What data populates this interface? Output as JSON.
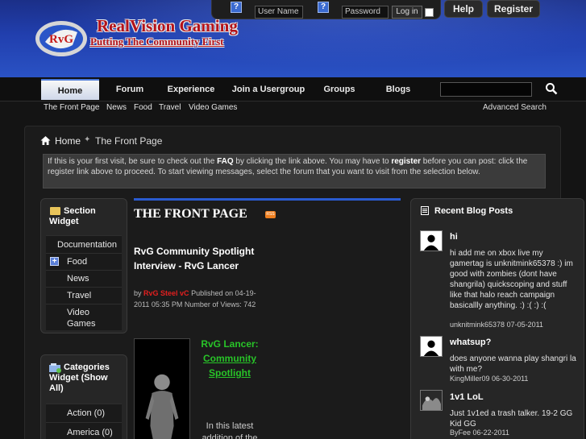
{
  "site": {
    "name": "RealVision Gaming",
    "slogan": "Putting The Community First",
    "badge": "RvG"
  },
  "login": {
    "username_placeholder": "User Name",
    "password_placeholder": "Password",
    "login_button": "Log in",
    "help_glyph": "?"
  },
  "top_tabs": {
    "help": "Help",
    "register": "Register"
  },
  "nav": {
    "tabs": [
      "Home",
      "Forum",
      "Experience",
      "Join a Usergroup",
      "Groups",
      "Blogs"
    ],
    "subnav": [
      "The Front Page",
      "News",
      "Food",
      "Travel",
      "Video Games"
    ],
    "advanced_search": "Advanced Search"
  },
  "breadcrumb": {
    "home": "Home",
    "separator": "✦",
    "current": "The Front Page"
  },
  "notice": {
    "part1": "If this is your first visit, be sure to check out the ",
    "faq": "FAQ",
    "part2": " by clicking the link above. You may have to ",
    "register": "register",
    "part3": " before you can post: click the register link above to proceed. To start viewing messages, select the forum that you want to visit from the selection below."
  },
  "section_widget": {
    "title": "Section Widget",
    "items": [
      "Documentation",
      "Food",
      "News",
      "Travel",
      "Video Games"
    ],
    "plus_glyph": "+"
  },
  "categories_widget": {
    "title": "Categories Widget (Show All)",
    "items": [
      "Action (0)",
      "America (0)"
    ]
  },
  "center": {
    "title": "THE FRONT PAGE",
    "rss_label": "RSS",
    "article": {
      "title": "RvG Community Spotlight Interview - RvG Lancer",
      "by": "by",
      "author": "RvG Steel vC",
      "published": "Published on 04-19-2011 05:35 PM",
      "views_label": "Number of Views:",
      "views": "742",
      "heading_line1": "RvG Lancer:",
      "heading_link": "Community Spotlight",
      "body": "In this latest addition of the"
    }
  },
  "recent_blog_posts": {
    "title": "Recent Blog Posts",
    "posts": [
      {
        "title": "hi",
        "body": "hi add me on xbox live my gamertag is unknitmink65378 :) im good with zombies (dont have shangrila) quickscoping and stuff like that halo reach campaign basicallly anything. :) :( :) :(",
        "author": "unknitmink65378",
        "date": "07-05-2011"
      },
      {
        "title": "whatsup?",
        "body": "does anyone wanna play shangri la with me?",
        "author": "KingMiller09",
        "date": "06-30-2011"
      },
      {
        "title": "1v1 LoL",
        "body": "Just 1v1ed a trash talker. 19-2 GG Kid GG",
        "author": "ByFee",
        "date": "06-22-2011"
      }
    ]
  },
  "colors": {
    "header_blue": "#213fae",
    "brand_red": "#b3121a",
    "accent_blue": "#2a5bd0",
    "spotlight_green": "#28c428",
    "author_red": "#e21f1f",
    "rss_orange": "#ee7f20"
  }
}
